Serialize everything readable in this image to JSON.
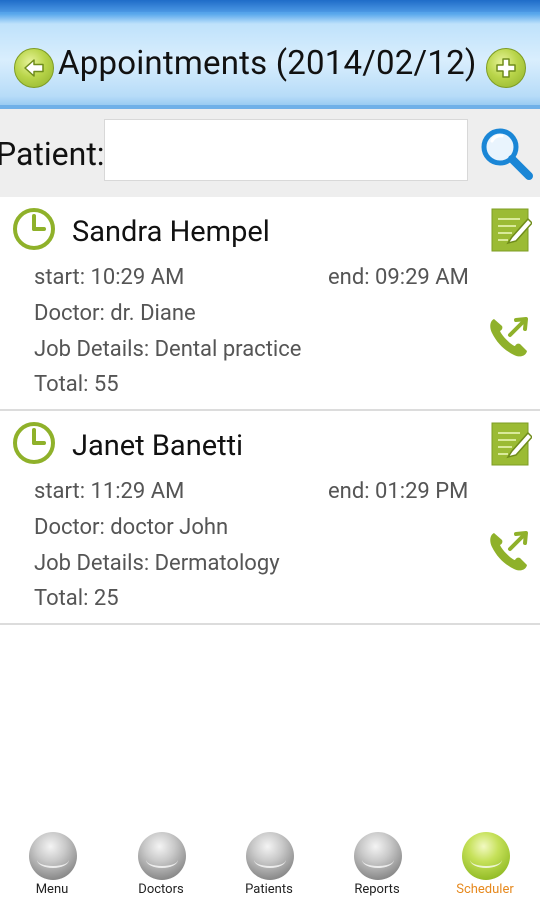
{
  "header": {
    "title": "Appointments (2014/02/12)"
  },
  "search": {
    "label": "Patient:",
    "value": "",
    "placeholder": ""
  },
  "appointments": [
    {
      "name": "Sandra Hempel",
      "start": "start: 10:29 AM",
      "end": "end: 09:29 AM",
      "doctor": "Doctor: dr. Diane",
      "job": "Job Details: Dental practice",
      "total": "Total: 55"
    },
    {
      "name": "Janet Banetti",
      "start": "start: 11:29 AM",
      "end": "end: 01:29 PM",
      "doctor": "Doctor: doctor John",
      "job": "Job Details: Dermatology",
      "total": "Total: 25"
    }
  ],
  "nav": {
    "items": [
      {
        "label": "Menu",
        "active": false
      },
      {
        "label": "Doctors",
        "active": false
      },
      {
        "label": "Patients",
        "active": false
      },
      {
        "label": "Reports",
        "active": false
      },
      {
        "label": "Scheduler",
        "active": true
      }
    ]
  },
  "colors": {
    "accent_green": "#8fb12a",
    "header_blue": "#2e7fd8",
    "active_nav": "#e6891e",
    "search_blue": "#1a86d6"
  },
  "icons": {
    "back": "arrow-left-icon",
    "add": "plus-icon",
    "search": "magnifier-icon",
    "clock": "clock-icon",
    "edit": "edit-note-icon",
    "call": "phone-call-icon",
    "nav": "sphere-icon"
  }
}
